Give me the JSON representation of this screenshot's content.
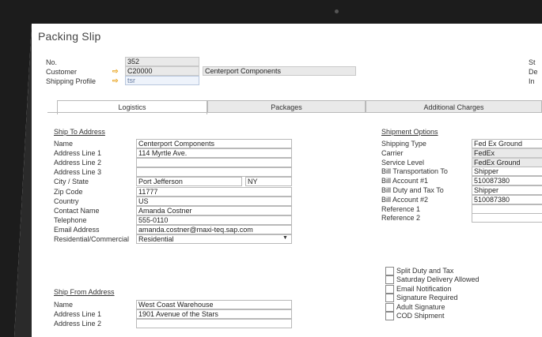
{
  "window": {
    "title": "Packing Slip"
  },
  "header": {
    "no_label": "No.",
    "no_value": "352",
    "customer_label": "Customer",
    "customer_code": "C20000",
    "customer_name": "Centerport Components",
    "shipping_profile_label": "Shipping Profile",
    "shipping_profile_value": "tsr",
    "right_labels": [
      "St",
      "De",
      "In"
    ]
  },
  "tabs": [
    {
      "label": "Logistics",
      "active": true
    },
    {
      "label": "Packages",
      "active": false
    },
    {
      "label": "Additional Charges",
      "active": false
    }
  ],
  "ship_to": {
    "section": "Ship To Address",
    "rows": [
      {
        "label": "Name",
        "value": "Centerport Components"
      },
      {
        "label": "Address Line 1",
        "value": "114 Myrtle Ave."
      },
      {
        "label": "Address Line 2",
        "value": ""
      },
      {
        "label": "Address Line 3",
        "value": ""
      },
      {
        "label": "City / State",
        "value": "Port Jefferson",
        "state": "NY"
      },
      {
        "label": "Zip Code",
        "value": "11777"
      },
      {
        "label": "Country",
        "value": "US"
      },
      {
        "label": "Contact Name",
        "value": "Amanda Costner"
      },
      {
        "label": "Telephone",
        "value": "555-0110"
      },
      {
        "label": "Email Address",
        "value": "amanda.costner@maxi-teq.sap.com"
      },
      {
        "label": "Residential/Commercial",
        "value": "Residential"
      }
    ]
  },
  "ship_from": {
    "section": "Ship From Address",
    "rows": [
      {
        "label": "Name",
        "value": "West Coast Warehouse"
      },
      {
        "label": "Address Line 1",
        "value": "1901 Avenue of the Stars"
      },
      {
        "label": "Address Line 2",
        "value": ""
      }
    ]
  },
  "shipment_options": {
    "section": "Shipment Options",
    "rows": [
      {
        "label": "Shipping Type",
        "value": "Fed Ex Ground"
      },
      {
        "label": "Carrier",
        "value": "FedEx"
      },
      {
        "label": "Service Level",
        "value": "FedEx Ground"
      },
      {
        "label": "Bill Transportation To",
        "value": "Shipper"
      },
      {
        "label": "Bill Account #1",
        "value": "510087380"
      },
      {
        "label": "Bill Duty and Tax To",
        "value": "Shipper"
      },
      {
        "label": "Bill Account #2",
        "value": "510087380"
      },
      {
        "label": "Reference 1",
        "value": ""
      },
      {
        "label": "Reference 2",
        "value": ""
      }
    ],
    "checkboxes": [
      "Split Duty and Tax",
      "Saturday Delivery Allowed",
      "Email Notification",
      "Signature Required",
      "Adult Signature",
      "COD Shipment"
    ]
  },
  "colors": {
    "accent": "#e8772e",
    "bezel": "#1e1e1e",
    "field_border": "#b9b9b9"
  }
}
